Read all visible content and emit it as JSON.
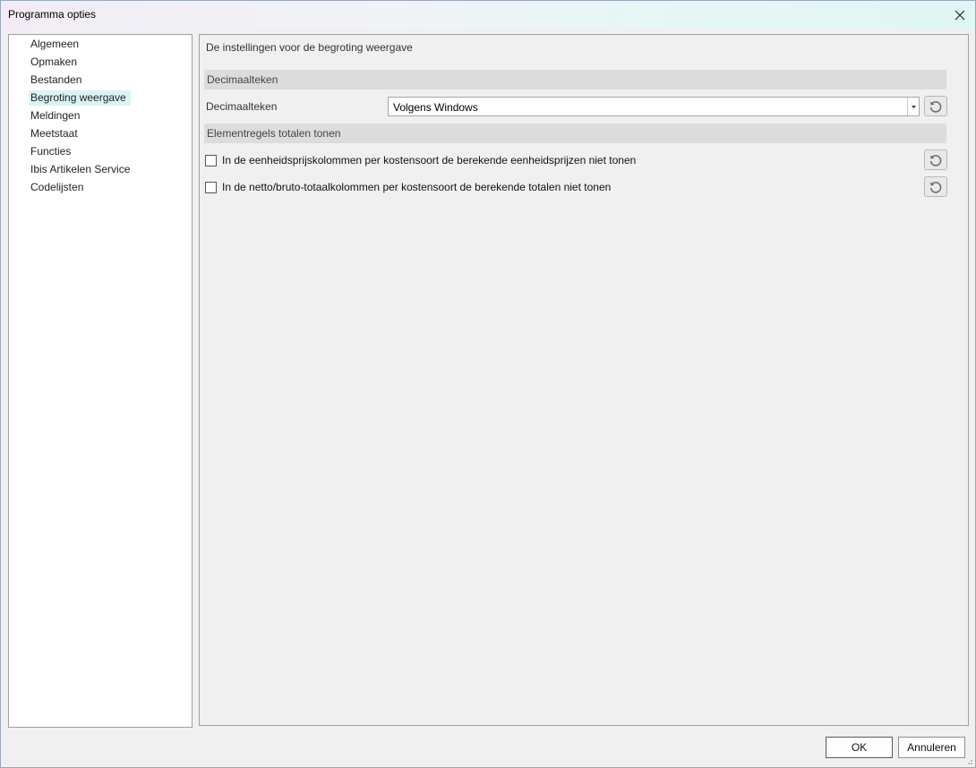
{
  "window": {
    "title": "Programma opties"
  },
  "sidebar": {
    "items": [
      {
        "label": "Algemeen"
      },
      {
        "label": "Opmaken"
      },
      {
        "label": "Bestanden"
      },
      {
        "label": "Begroting weergave",
        "selected": true
      },
      {
        "label": "Meldingen"
      },
      {
        "label": "Meetstaat"
      },
      {
        "label": "Functies"
      },
      {
        "label": "Ibis Artikelen Service"
      },
      {
        "label": "Codelijsten"
      }
    ]
  },
  "content": {
    "description": "De instellingen voor de begroting weergave",
    "decimal_section": {
      "header": "Decimaalteken",
      "field_label": "Decimaalteken",
      "select_value": "Volgens Windows"
    },
    "totals_section": {
      "header": "Elementregels totalen tonen",
      "options": [
        {
          "label": "In de eenheidsprijskolommen per kostensoort de berekende eenheidsprijzen niet tonen",
          "checked": false
        },
        {
          "label": "In de netto/bruto-totaalkolommen per kostensoort de berekende totalen niet tonen",
          "checked": false
        }
      ]
    }
  },
  "footer": {
    "ok_label": "OK",
    "cancel_label": "Annuleren"
  },
  "icons": {
    "close": "close-icon",
    "reset": "reset-icon",
    "dropdown": "chevron-down-icon"
  },
  "colors": {
    "selected_bg": "#d9f4f4",
    "section_bg": "#dcdcdc"
  }
}
